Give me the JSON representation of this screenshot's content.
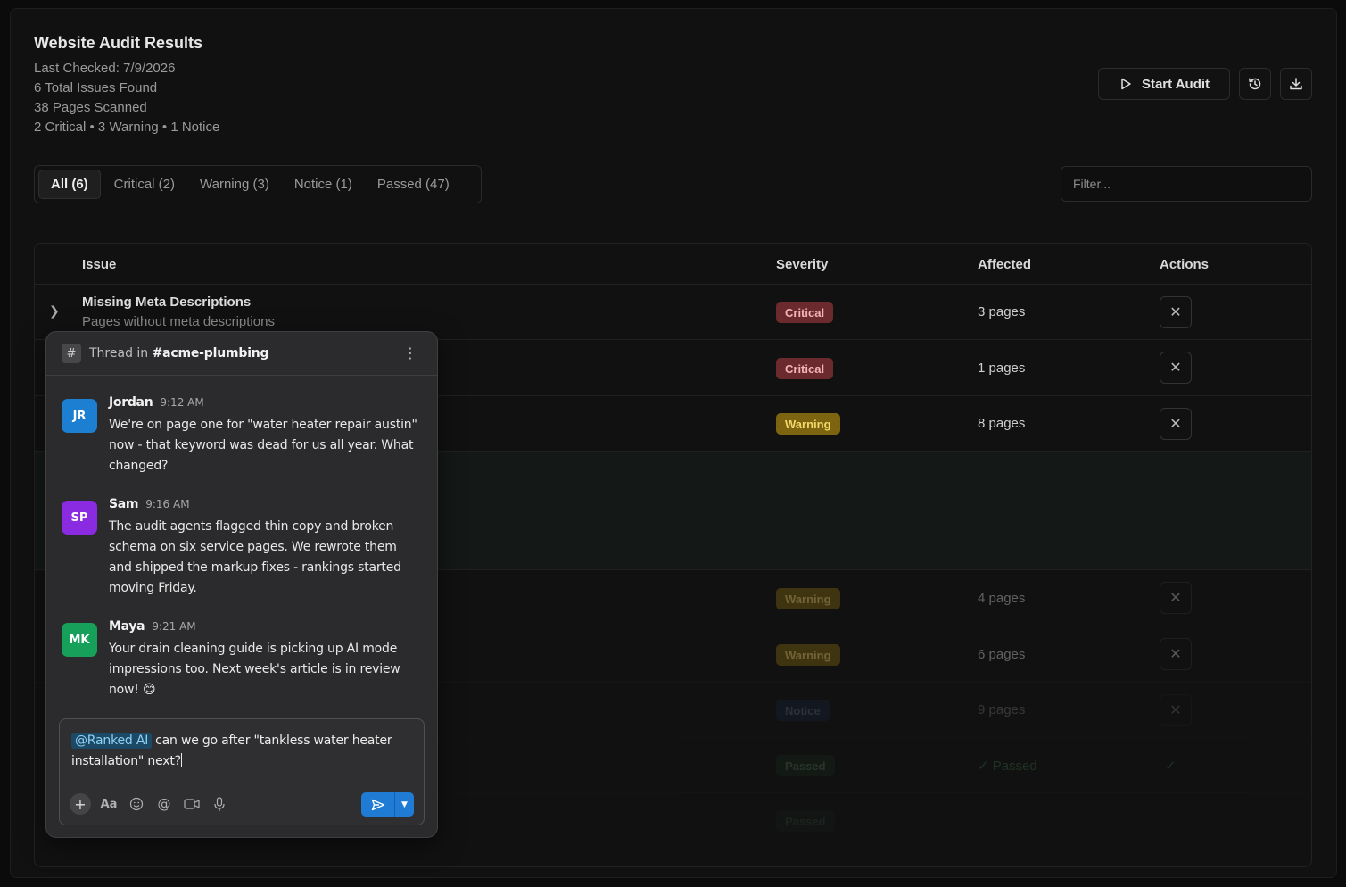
{
  "audit": {
    "title": "Website Audit Results",
    "meta": [
      "Last Checked: 7/9/2026",
      "6 Total Issues Found",
      "38 Pages Scanned",
      "2 Critical • 3 Warning • 1 Notice"
    ],
    "start_label": "Start Audit"
  },
  "tabs": [
    "All (6)",
    "Critical (2)",
    "Warning (3)",
    "Notice (1)",
    "Passed (47)"
  ],
  "filter_placeholder": "Filter...",
  "table": {
    "headers": [
      "Issue",
      "Severity",
      "Affected",
      "Actions"
    ],
    "rows": [
      {
        "title": "Missing Meta Descriptions",
        "desc": "Pages without meta descriptions",
        "severity": "Critical",
        "affected": "3 pages"
      },
      {
        "severity": "Critical",
        "affected": "1 pages"
      },
      {
        "severity": "Warning",
        "affected": "8 pages"
      },
      {
        "severity": "Warning",
        "affected": "4 pages"
      },
      {
        "severity": "Warning",
        "affected": "6 pages"
      },
      {
        "severity": "Notice",
        "affected": "9 pages"
      },
      {
        "severity": "Passed",
        "affected": "✓ Passed",
        "action": "✓"
      },
      {
        "severity": "Passed"
      }
    ]
  },
  "thread": {
    "prefix": "Thread in",
    "channel": "#acme-plumbing",
    "messages": [
      {
        "initials": "JR",
        "name": "Jordan",
        "time": "9:12 AM",
        "color": "#1d7fd1",
        "text": "We're on page one for \"water heater repair austin\" now - that keyword was dead for us all year. What changed?"
      },
      {
        "initials": "SP",
        "name": "Sam",
        "time": "9:16 AM",
        "color": "#8a2be2",
        "text": "The audit agents flagged thin copy and broken schema on six service pages. We rewrote them and shipped the markup fixes - rankings started moving Friday."
      },
      {
        "initials": "MK",
        "name": "Maya",
        "time": "9:21 AM",
        "color": "#16a05a",
        "text": "Your drain cleaning guide is picking up AI mode impressions too. Next week's article is in review now! 😊"
      }
    ],
    "composer": {
      "mention": "@Ranked AI",
      "text": "can we go after \"tankless water heater installation\" next?"
    }
  }
}
